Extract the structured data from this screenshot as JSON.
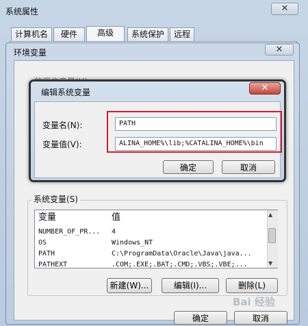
{
  "outer_window": {
    "title": "系统属性",
    "close_glyph": "✕",
    "tabs": [
      {
        "label": "计算机名"
      },
      {
        "label": "硬件"
      },
      {
        "label": "高级"
      },
      {
        "label": "系统保护"
      },
      {
        "label": "远程"
      }
    ],
    "ok_label": "确定",
    "cancel_label": "取消"
  },
  "env_window": {
    "title": "环境变量",
    "close_glyph": "✕",
    "user_vars_label": "的用户变量(U)",
    "system_vars_label": "系统变量(S)",
    "table": {
      "headers": [
        "变量",
        "值"
      ],
      "rows": [
        {
          "name": "NUMBER_OF_PR...",
          "value": "4"
        },
        {
          "name": "OS",
          "value": "Windows_NT"
        },
        {
          "name": "PATH",
          "value": "C:\\ProgramData\\Oracle\\Java\\java..."
        },
        {
          "name": "PATHEXT",
          "value": ".COM;.EXE;.BAT;.CMD;.VBS;.VBE;..."
        }
      ]
    },
    "new_label": "新建(W)...",
    "edit_label": "编辑(I)...",
    "delete_label": "删除(L)"
  },
  "edit_dialog": {
    "title": "编辑系统变量",
    "close_glyph": "✕",
    "name_label": "变量名(N):",
    "value_label": "变量值(V):",
    "name_value": "PATH",
    "value_value": "ALINA_HOME%\\lib;%CATALINA_HOME%\\bin",
    "ok_label": "确定",
    "cancel_label": "取消"
  },
  "highlight_color": "#d8192a",
  "watermark": "Bai 经验"
}
